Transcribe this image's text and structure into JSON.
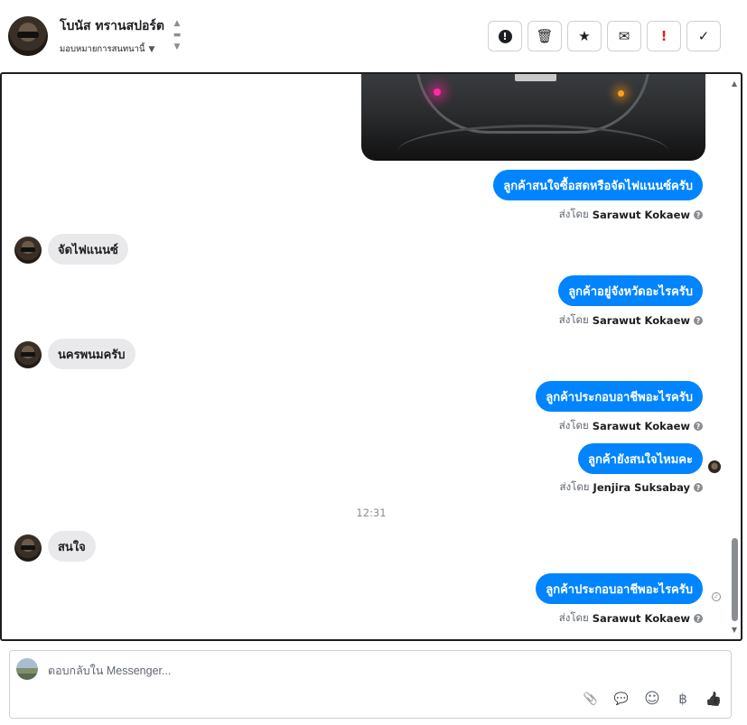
{
  "header": {
    "contact_name": "โบนัส ทรานสปอร์ต",
    "assign_label": "มอบหมายการสนทนานี้",
    "actions": [
      {
        "icon": "alert-circle-icon",
        "glyph": "!"
      },
      {
        "icon": "trash-icon",
        "glyph": "🗑"
      },
      {
        "icon": "star-icon",
        "glyph": "★"
      },
      {
        "icon": "envelope-icon",
        "glyph": "✉"
      },
      {
        "icon": "exclamation-icon",
        "glyph": "!"
      },
      {
        "icon": "checkmark-icon",
        "glyph": "✓"
      }
    ]
  },
  "thread": {
    "messages": [
      {
        "dir": "out",
        "text": "ลูกค้าสนใจซื้อสดหรือจัดไฟแนนซ์ครับ",
        "sent_by_label": "ส่งโดย",
        "sender": "Sarawut Kokaew"
      },
      {
        "dir": "in",
        "text": "จัดไฟแนนซ์"
      },
      {
        "dir": "out",
        "text": "ลูกค้าอยู่จังหวัดอะไรครับ",
        "sent_by_label": "ส่งโดย",
        "sender": "Sarawut Kokaew"
      },
      {
        "dir": "in",
        "text": "นครพนมครับ"
      },
      {
        "dir": "out",
        "text": "ลูกค้าประกอบอาชีพอะไรครับ",
        "sent_by_label": "ส่งโดย",
        "sender": "Sarawut Kokaew"
      },
      {
        "dir": "out",
        "text": "ลูกค้ายังสนใจไหมคะ",
        "sent_by_label": "ส่งโดย",
        "sender": "Jenjira Suksabay"
      },
      {
        "dir": "in",
        "text": "สนใจ"
      },
      {
        "dir": "out",
        "text": "ลูกค้าประกอบอาชีพอะไรครับ",
        "sent_by_label": "ส่งโดย",
        "sender": "Sarawut Kokaew"
      }
    ],
    "time_separator": "12:31"
  },
  "composer": {
    "placeholder": "ตอบกลับใน Messenger...",
    "tools": [
      {
        "icon": "paperclip-icon",
        "glyph": "📎"
      },
      {
        "icon": "saved-reply-icon",
        "glyph": "💬"
      },
      {
        "icon": "emoji-icon",
        "glyph": "☺"
      },
      {
        "icon": "baht-icon",
        "glyph": "฿"
      },
      {
        "icon": "thumbs-up-icon",
        "glyph": "👍"
      }
    ]
  }
}
